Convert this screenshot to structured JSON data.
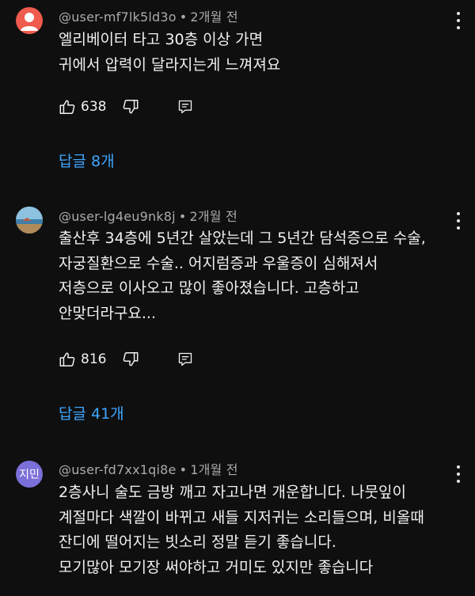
{
  "comments": [
    {
      "author": "@user-mf7lk5ld3o",
      "time": "2개월 전",
      "avatar_color": "#ef5b4c",
      "avatar_icon": "person-icon",
      "lines": [
        "엘리베이터 타고 30층 이상 가면",
        "귀에서  압력이 달라지는게 느껴져요"
      ],
      "likes": "638",
      "replies_label": "답글 8개"
    },
    {
      "author": "@user-lg4eu9nk8j",
      "time": "2개월 전",
      "avatar_icon": "landscape-photo-icon",
      "lines": [
        "출산후 34층에 5년간 살았는데 그 5년간 담석증으로 수술,",
        "자궁질환으로 수술.. 어지럼증과 우울증이 심해져서",
        "저층으로 이사오고 많이 좋아졌습니다. 고층하고",
        "안맞더라구요..."
      ],
      "likes": "816",
      "replies_label": "답글 41개"
    },
    {
      "author": "@user-fd7xx1qi8e",
      "time": "1개월 전",
      "avatar_color": "#7b6fd8",
      "avatar_text": "지민",
      "lines": [
        "2층사니 술도 금방 깨고 자고나면 개운합니다. 나뭇잎이",
        "계절마다 색깔이 바뀌고 새들 지저귀는 소리들으며, 비올때",
        "잔디에 떨어지는 빗소리 정말 듣기 좋습니다.",
        "모기많아 모기장 써야하고  거미도 있지만 좋습니다"
      ]
    }
  ],
  "icons": {
    "like": "thumbs-up-icon",
    "dislike": "thumbs-down-icon",
    "reply": "reply-comment-icon",
    "more": "more-vertical-icon"
  }
}
